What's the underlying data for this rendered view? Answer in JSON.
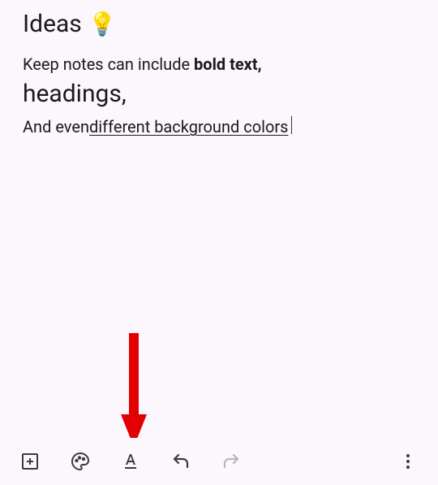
{
  "note": {
    "title": "Ideas",
    "emoji": "💡",
    "line1_prefix": "Keep notes can include ",
    "line1_bold": "bold text,",
    "heading_line": "headings,",
    "line3_prefix": "And even ",
    "line3_underlined": "different background colors"
  },
  "icons": {
    "add": "add-box-icon",
    "palette": "palette-icon",
    "text_format": "text-format-icon",
    "undo": "undo-icon",
    "redo": "redo-icon",
    "more": "more-vert-icon"
  },
  "colors": {
    "arrow": "#e30000"
  }
}
